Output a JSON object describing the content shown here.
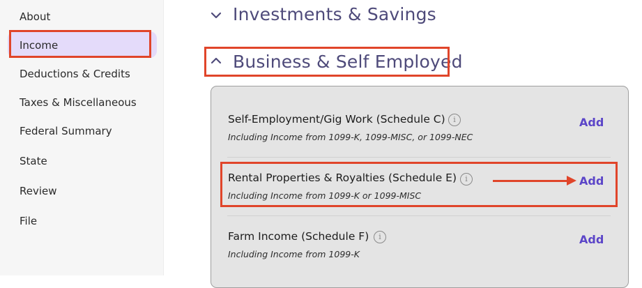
{
  "sidebar": {
    "items": [
      {
        "label": "About"
      },
      {
        "label": "Income"
      },
      {
        "label": "Deductions & Credits"
      },
      {
        "label": "Taxes & Miscellaneous"
      },
      {
        "label": "Federal Summary"
      },
      {
        "label": "State"
      },
      {
        "label": "Review"
      },
      {
        "label": "File"
      }
    ],
    "active": "Income"
  },
  "main": {
    "sections": [
      {
        "title": "Investments & Savings",
        "expanded": false
      },
      {
        "title": "Business & Self Employed",
        "expanded": true
      }
    ],
    "rows": [
      {
        "title": "Self-Employment/Gig Work (Schedule C)",
        "subtitle": "Including Income from 1099-K, 1099-MISC, or 1099-NEC",
        "action": "Add"
      },
      {
        "title": "Rental Properties & Royalties (Schedule E)",
        "subtitle": "Including Income from 1099-K or 1099-MISC",
        "action": "Add"
      },
      {
        "title": "Farm Income (Schedule F)",
        "subtitle": "Including Income from 1099-K",
        "action": "Add"
      }
    ]
  },
  "colors": {
    "accent": "#5b45c8",
    "highlight": "#e0452a",
    "active_nav_bg": "#e4dbfa",
    "section_title": "#4e4a7a"
  }
}
